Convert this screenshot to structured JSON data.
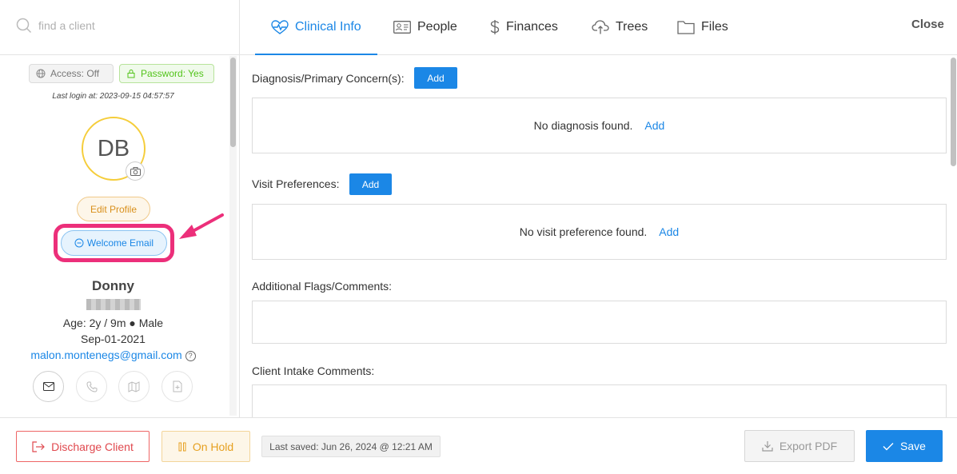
{
  "search": {
    "placeholder": "find a client"
  },
  "profile": {
    "access_label": "Access: Off",
    "password_label": "Password: Yes",
    "last_login": "Last login at: 2023-09-15 04:57:57",
    "initials": "DB",
    "edit_profile_label": "Edit Profile",
    "welcome_email_label": "Welcome Email",
    "name": "Donny",
    "age_line": "Age: 2y / 9m ● Male",
    "dob": "Sep-01-2021",
    "email": "malon.montenegs@gmail.com",
    "help_glyph": "?"
  },
  "tabs": [
    {
      "label": "Clinical Info",
      "icon": "heartbeat-icon"
    },
    {
      "label": "People",
      "icon": "id-card-icon"
    },
    {
      "label": "Finances",
      "icon": "dollar-icon"
    },
    {
      "label": "Trees",
      "icon": "cloud-upload-icon"
    },
    {
      "label": "Files",
      "icon": "folder-icon"
    }
  ],
  "close_label": "Close",
  "clinical": {
    "diagnosis_label": "Diagnosis/Primary Concern(s):",
    "diagnosis_add": "Add",
    "diagnosis_empty": "No diagnosis found.",
    "diagnosis_empty_add": "Add",
    "visit_label": "Visit Preferences:",
    "visit_add": "Add",
    "visit_empty": "No visit preference found.",
    "visit_empty_add": "Add",
    "flags_label": "Additional Flags/Comments:",
    "intake_label": "Client Intake Comments:"
  },
  "footer": {
    "discharge_label": "Discharge Client",
    "onhold_label": "On Hold",
    "last_saved": "Last saved: Jun 26, 2024 @ 12:21 AM",
    "export_label": "Export PDF",
    "save_label": "Save"
  },
  "colors": {
    "accent": "#1b87e6",
    "highlight": "#ec2f7a",
    "danger": "#e0484e",
    "warning": "#e6a020",
    "success": "#52c41a"
  }
}
